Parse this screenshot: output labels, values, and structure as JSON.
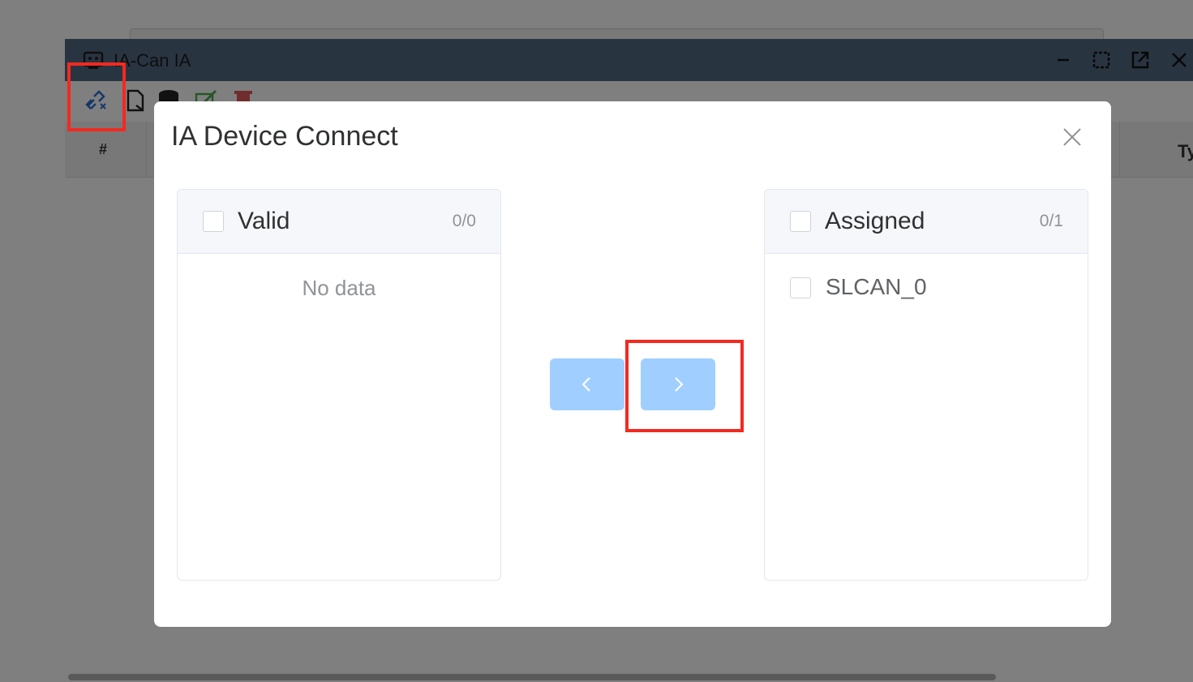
{
  "window": {
    "title": "IA-Can IA",
    "icon": "app-window-icon",
    "controls": [
      "minimize-icon",
      "maximize-icon",
      "popout-icon",
      "close-icon"
    ]
  },
  "toolbar": {
    "icons": [
      "unlink-icon",
      "import-file-icon",
      "database-icon",
      "edit-icon",
      "delete-icon"
    ]
  },
  "table": {
    "columns": [
      "#",
      "Ty"
    ]
  },
  "dialog": {
    "title": "IA Device Connect",
    "left_panel": {
      "title": "Valid",
      "count": "0/0",
      "empty_text": "No data",
      "items": []
    },
    "right_panel": {
      "title": "Assigned",
      "count": "0/1",
      "items": [
        "SLCAN_0"
      ]
    },
    "buttons": {
      "move_left": "chevron-left-icon",
      "move_right": "chevron-right-icon"
    }
  },
  "colors": {
    "titlebar": "#536983",
    "button_disabled": "#a0cfff",
    "highlight": "#f22a21",
    "overlay": "rgba(0,0,0,0.5)"
  }
}
